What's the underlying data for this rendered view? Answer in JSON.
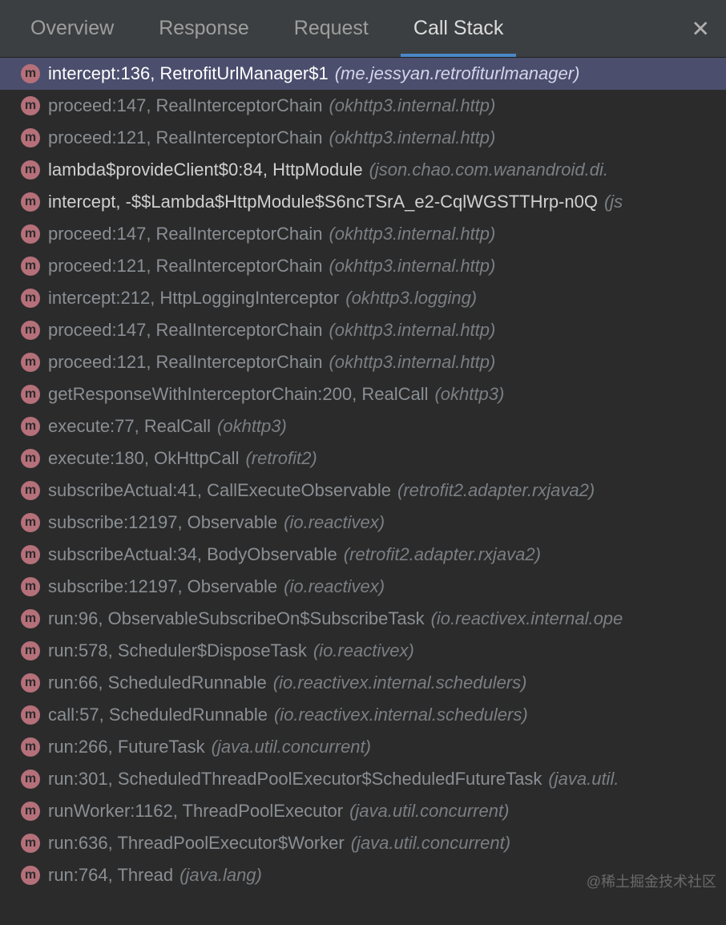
{
  "tabs": {
    "overview": "Overview",
    "response": "Response",
    "request": "Request",
    "callstack": "Call Stack"
  },
  "icon_letter": "m",
  "watermark": "@稀土掘金技术社区",
  "frames": [
    {
      "main": "intercept:136, RetrofitUrlManager$1",
      "pkg": "(me.jessyan.retrofiturlmanager)",
      "selected": true,
      "app": true
    },
    {
      "main": "proceed:147, RealInterceptorChain",
      "pkg": "(okhttp3.internal.http)"
    },
    {
      "main": "proceed:121, RealInterceptorChain",
      "pkg": "(okhttp3.internal.http)"
    },
    {
      "main": "lambda$provideClient$0:84, HttpModule",
      "pkg": "(json.chao.com.wanandroid.di.",
      "app": true
    },
    {
      "main": "intercept, -$$Lambda$HttpModule$S6ncTSrA_e2-CqlWGSTTHrp-n0Q",
      "pkg": "(js",
      "app": true
    },
    {
      "main": "proceed:147, RealInterceptorChain",
      "pkg": "(okhttp3.internal.http)"
    },
    {
      "main": "proceed:121, RealInterceptorChain",
      "pkg": "(okhttp3.internal.http)"
    },
    {
      "main": "intercept:212, HttpLoggingInterceptor",
      "pkg": "(okhttp3.logging)"
    },
    {
      "main": "proceed:147, RealInterceptorChain",
      "pkg": "(okhttp3.internal.http)"
    },
    {
      "main": "proceed:121, RealInterceptorChain",
      "pkg": "(okhttp3.internal.http)"
    },
    {
      "main": "getResponseWithInterceptorChain:200, RealCall",
      "pkg": "(okhttp3)"
    },
    {
      "main": "execute:77, RealCall",
      "pkg": "(okhttp3)"
    },
    {
      "main": "execute:180, OkHttpCall",
      "pkg": "(retrofit2)"
    },
    {
      "main": "subscribeActual:41, CallExecuteObservable",
      "pkg": "(retrofit2.adapter.rxjava2)"
    },
    {
      "main": "subscribe:12197, Observable",
      "pkg": "(io.reactivex)"
    },
    {
      "main": "subscribeActual:34, BodyObservable",
      "pkg": "(retrofit2.adapter.rxjava2)"
    },
    {
      "main": "subscribe:12197, Observable",
      "pkg": "(io.reactivex)"
    },
    {
      "main": "run:96, ObservableSubscribeOn$SubscribeTask",
      "pkg": "(io.reactivex.internal.ope"
    },
    {
      "main": "run:578, Scheduler$DisposeTask",
      "pkg": "(io.reactivex)"
    },
    {
      "main": "run:66, ScheduledRunnable",
      "pkg": "(io.reactivex.internal.schedulers)"
    },
    {
      "main": "call:57, ScheduledRunnable",
      "pkg": "(io.reactivex.internal.schedulers)"
    },
    {
      "main": "run:266, FutureTask",
      "pkg": "(java.util.concurrent)"
    },
    {
      "main": "run:301, ScheduledThreadPoolExecutor$ScheduledFutureTask",
      "pkg": "(java.util."
    },
    {
      "main": "runWorker:1162, ThreadPoolExecutor",
      "pkg": "(java.util.concurrent)"
    },
    {
      "main": "run:636, ThreadPoolExecutor$Worker",
      "pkg": "(java.util.concurrent)"
    },
    {
      "main": "run:764, Thread",
      "pkg": "(java.lang)"
    }
  ]
}
